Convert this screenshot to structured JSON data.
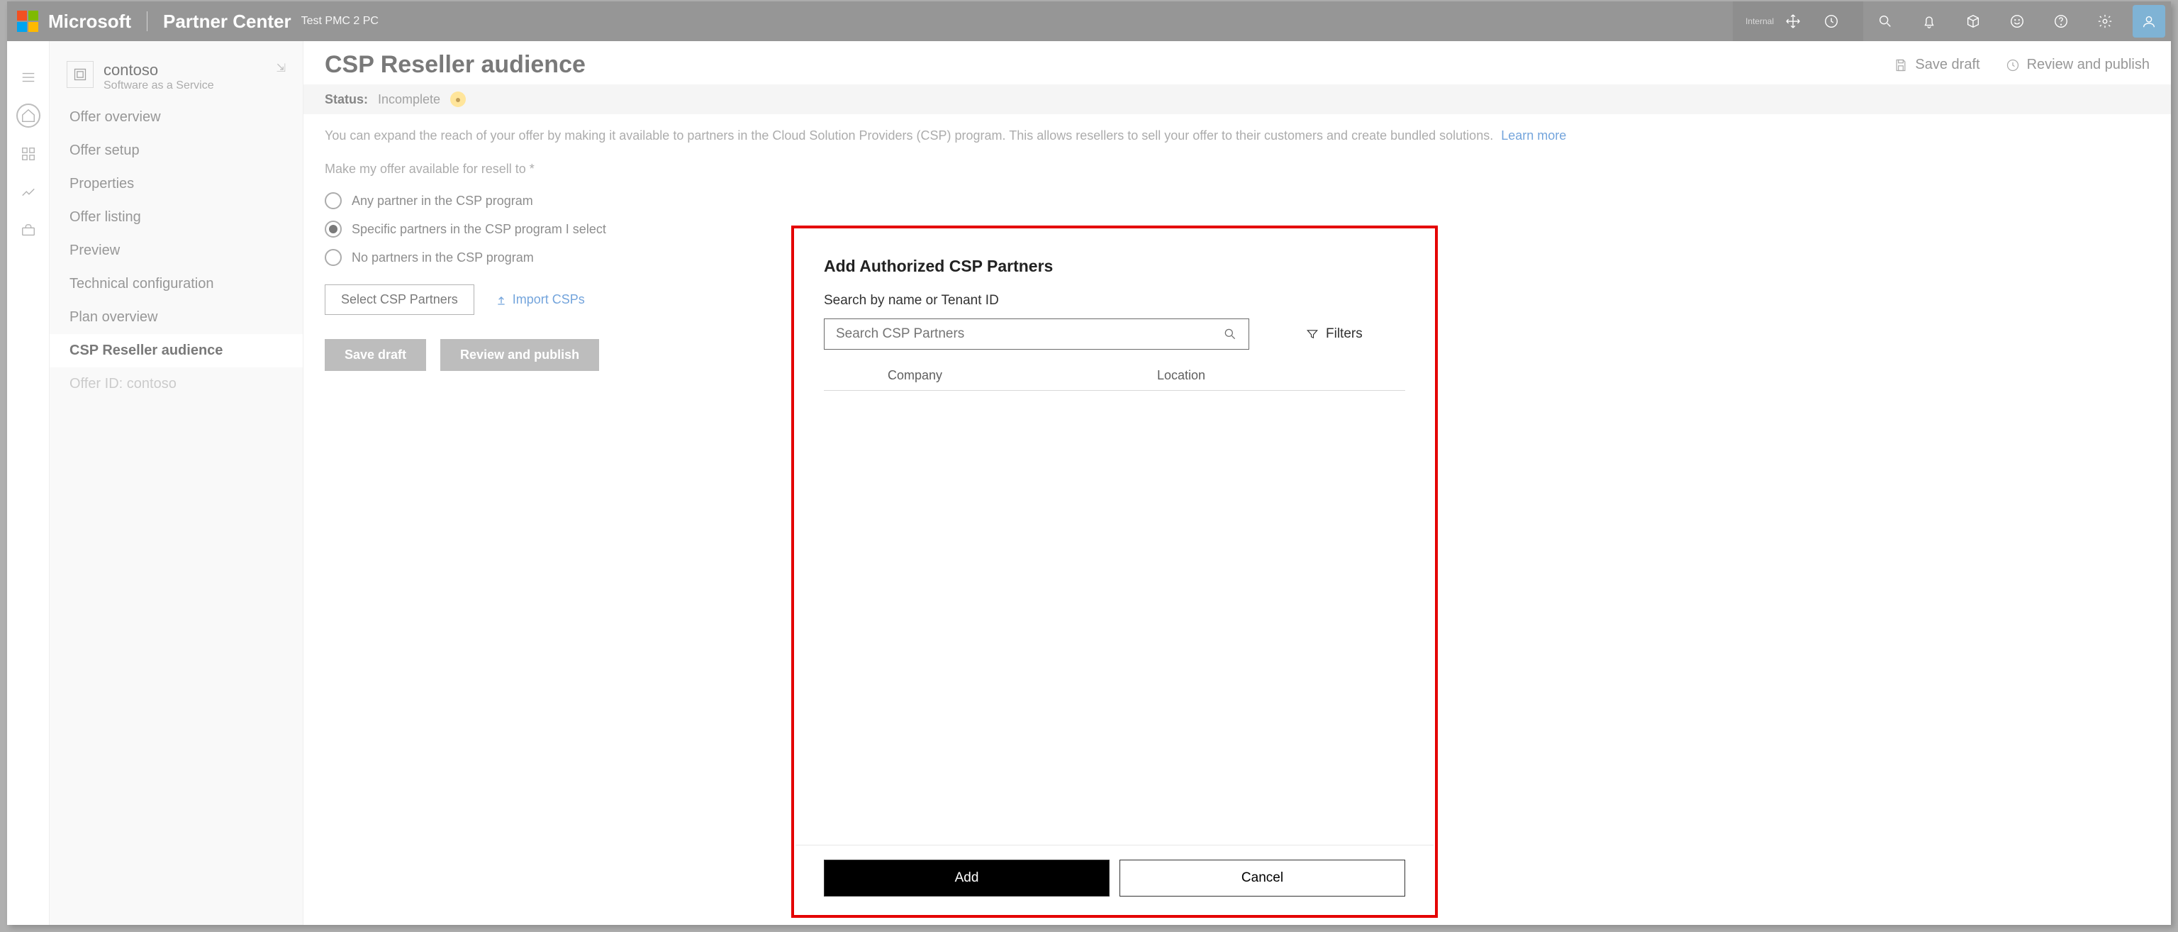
{
  "header": {
    "brand": "Microsoft",
    "product": "Partner Center",
    "env": "Test PMC 2 PC",
    "internal": "Internal"
  },
  "sidebar": {
    "offer": {
      "name": "contoso",
      "subtitle": "Software as a Service"
    },
    "items": [
      {
        "label": "Offer overview"
      },
      {
        "label": "Offer setup"
      },
      {
        "label": "Properties"
      },
      {
        "label": "Offer listing"
      },
      {
        "label": "Preview"
      },
      {
        "label": "Technical configuration"
      },
      {
        "label": "Plan overview"
      },
      {
        "label": "CSP Reseller audience"
      },
      {
        "label": "Offer ID: contoso"
      }
    ],
    "selected_index": 7
  },
  "page": {
    "title": "CSP Reseller audience",
    "actions": {
      "save_draft": "Save draft",
      "review_publish": "Review and publish"
    },
    "status_label": "Status:",
    "status_value": "Incomplete",
    "description": "You can expand the reach of your offer by making it available to partners in the Cloud Solution Providers (CSP) program. This allows resellers to sell your offer to their customers and create bundled solutions.",
    "learn_more": "Learn more",
    "resell_label": "Make my offer available for resell to",
    "radios": [
      "Any partner in the CSP program",
      "Specific partners in the CSP program I select",
      "No partners in the CSP program"
    ],
    "radio_selected": 1,
    "select_partners_btn": "Select CSP Partners",
    "import_link": "Import CSPs"
  },
  "modal": {
    "title": "Add Authorized CSP Partners",
    "search_label": "Search by name or Tenant ID",
    "search_placeholder": "Search CSP Partners",
    "filters": "Filters",
    "cols": {
      "company": "Company",
      "location": "Location"
    },
    "add_btn": "Add",
    "cancel_btn": "Cancel"
  }
}
